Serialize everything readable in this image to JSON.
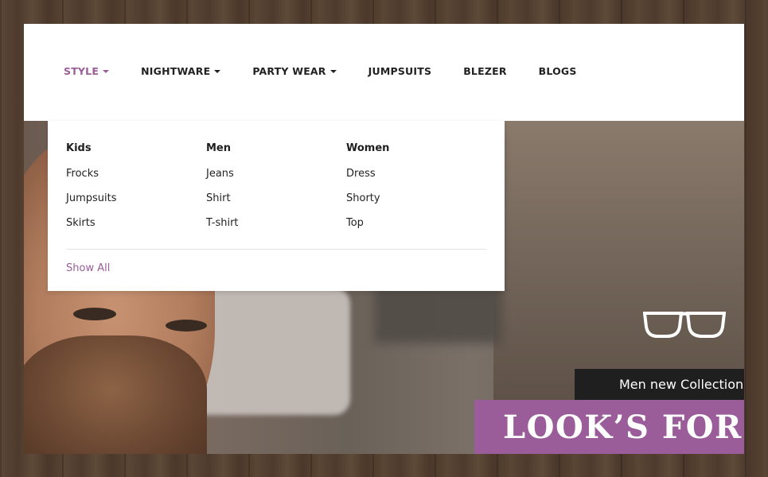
{
  "nav": {
    "items": [
      {
        "label": "STYLE",
        "has_caret": true,
        "active": true
      },
      {
        "label": "NIGHTWARE",
        "has_caret": true,
        "active": false
      },
      {
        "label": "PARTY WEAR",
        "has_caret": true,
        "active": false
      },
      {
        "label": "JUMPSUITS",
        "has_caret": false,
        "active": false
      },
      {
        "label": "BLEZER",
        "has_caret": false,
        "active": false
      },
      {
        "label": "BLOGS",
        "has_caret": false,
        "active": false
      }
    ]
  },
  "dropdown": {
    "columns": [
      {
        "heading": "Kids",
        "items": [
          "Frocks",
          "Jumpsuits",
          "Skirts"
        ]
      },
      {
        "heading": "Men",
        "items": [
          "Jeans",
          "Shirt",
          "T-shirt"
        ]
      },
      {
        "heading": "Women",
        "items": [
          "Dress",
          "Shorty",
          "Top"
        ]
      }
    ],
    "show_all": "Show All"
  },
  "hero": {
    "collection_label": "Men new Collection",
    "headline": "LOOK’S FOR",
    "icon": "eyeglasses-icon"
  },
  "colors": {
    "accent": "#9b5d9a",
    "dark_banner": "#1f1f1f",
    "text": "#222222"
  }
}
